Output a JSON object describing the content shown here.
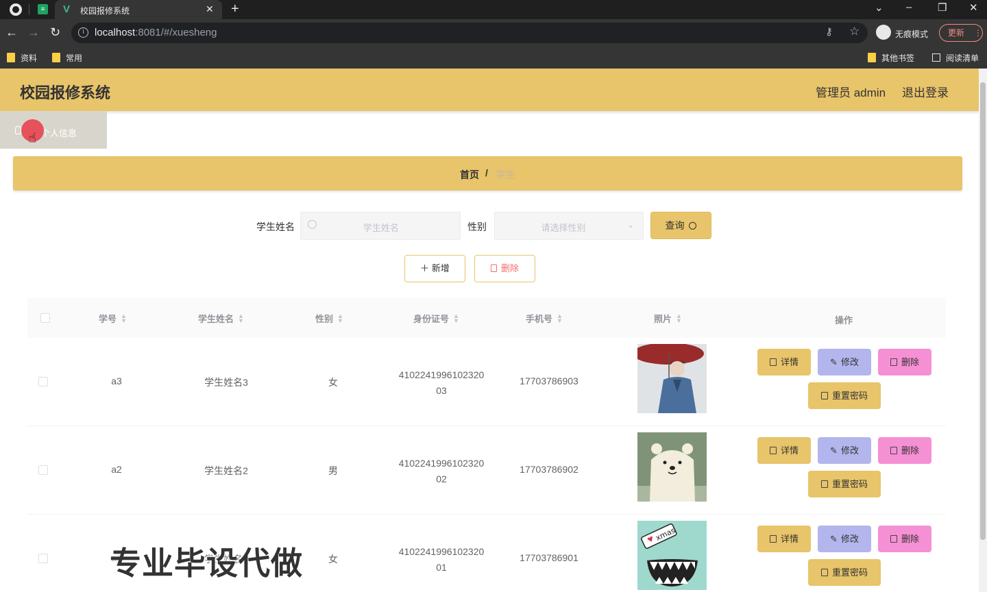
{
  "browser": {
    "tab_title": "校园报修系统",
    "url_host": "localhost",
    "url_path": ":8081/#/xuesheng",
    "incognito_label": "无痕模式",
    "update_label": "更新",
    "bookmarks": [
      "资料",
      "常用"
    ],
    "other_bookmarks": "其他书签",
    "reading_list": "阅读清单"
  },
  "header": {
    "title": "校园报修系统",
    "admin_label": "管理员 admin",
    "logout_label": "退出登录"
  },
  "menu": {
    "item_label": "个人信息"
  },
  "breadcrumb": {
    "home": "首页",
    "separator": "/",
    "current": "学生"
  },
  "search": {
    "name_label": "学生姓名",
    "name_placeholder": "学生姓名",
    "gender_label": "性别",
    "gender_placeholder": "请选择性别",
    "query_label": "查询"
  },
  "actions": {
    "add_label": "新增",
    "delete_label": "删除"
  },
  "table": {
    "headers": {
      "student_no": "学号",
      "name": "学生姓名",
      "gender": "性别",
      "id_card": "身份证号",
      "phone": "手机号",
      "photo": "照片",
      "operations": "操作"
    },
    "buttons": {
      "detail": "详情",
      "edit": "修改",
      "delete": "删除",
      "reset_password": "重置密码"
    },
    "rows": [
      {
        "student_no": "a3",
        "name": "学生姓名3",
        "gender": "女",
        "id_line1": "4102241996102320",
        "id_line2": "03",
        "phone": "17703786903"
      },
      {
        "student_no": "a2",
        "name": "学生姓名2",
        "gender": "男",
        "id_line1": "4102241996102320",
        "id_line2": "02",
        "phone": "17703786902"
      },
      {
        "student_no": "a1",
        "name": "学生姓名1",
        "gender": "女",
        "id_line1": "4102241996102320",
        "id_line2": "01",
        "phone": "17703786901"
      }
    ]
  },
  "watermark": "专业毕设代做",
  "colors": {
    "accent": "#e8c46a",
    "edit": "#b3b6ec",
    "delete": "#f590d4",
    "danger": "#f56c6c"
  }
}
